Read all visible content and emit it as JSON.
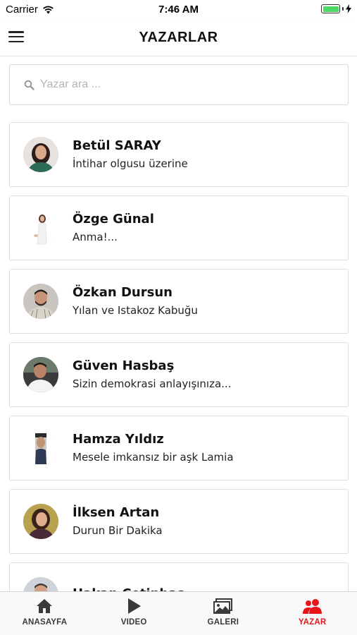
{
  "status_bar": {
    "carrier": "Carrier",
    "time": "7:46 AM",
    "battery_level": 1.0
  },
  "header": {
    "title": "YAZARLAR"
  },
  "search": {
    "placeholder": "Yazar ara ..."
  },
  "authors": [
    {
      "name": "Betül SARAY",
      "article": "İntihar olgusu üzerine"
    },
    {
      "name": "Özge Günal",
      "article": "Anma!..."
    },
    {
      "name": "Özkan Dursun",
      "article": "Yılan ve Istakoz Kabuğu"
    },
    {
      "name": "Güven Hasbaş",
      "article": "Sizin demokrasi anlayışınıza..."
    },
    {
      "name": "Hamza Yıldız",
      "article": "Mesele imkansız bir aşk Lamia"
    },
    {
      "name": "İlksen Artan",
      "article": "Durun Bir Dakika"
    },
    {
      "name": "Hakan Çetinbaş",
      "article": ""
    }
  ],
  "tabs": [
    {
      "label": "ANASAYFA",
      "icon": "home-icon",
      "active": false
    },
    {
      "label": "VIDEO",
      "icon": "play-icon",
      "active": false
    },
    {
      "label": "GALERI",
      "icon": "gallery-icon",
      "active": false
    },
    {
      "label": "YAZAR",
      "icon": "authors-icon",
      "active": true
    }
  ],
  "colors": {
    "accent": "#e8161b",
    "tab_inactive": "#3a3a3a",
    "battery": "#4cd964"
  }
}
